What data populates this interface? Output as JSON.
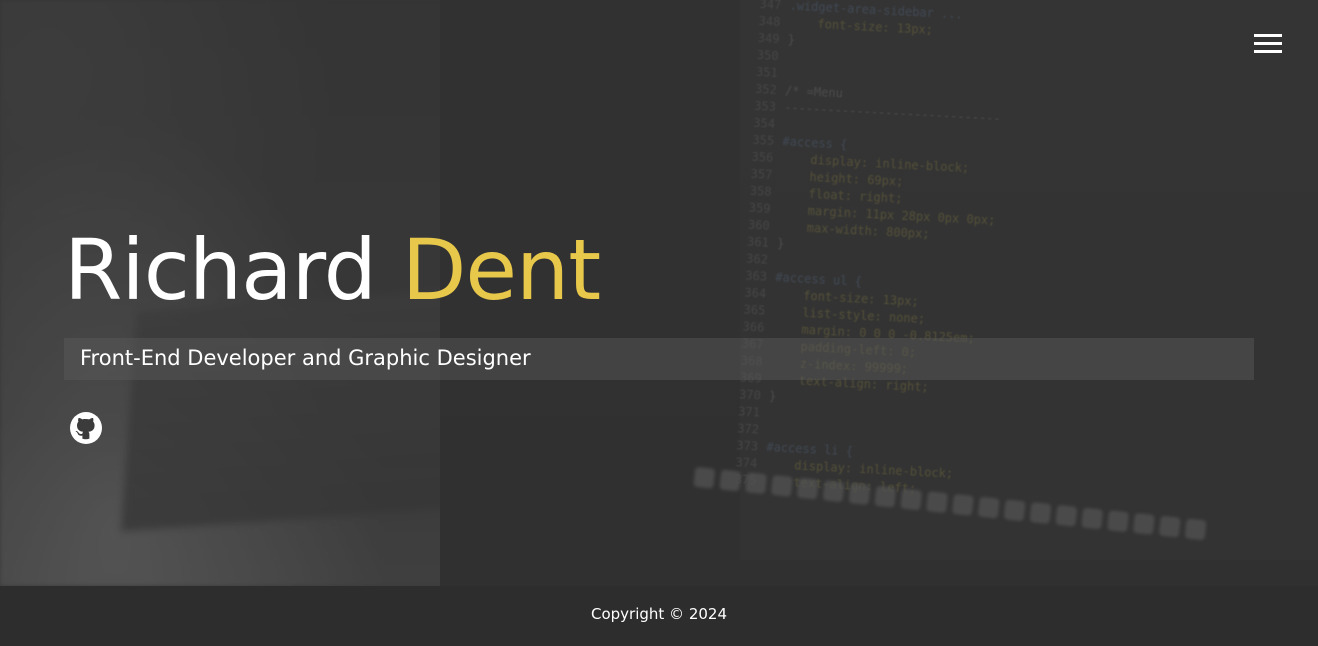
{
  "header": {
    "menu_icon": "hamburger-menu-icon"
  },
  "hero": {
    "first_name": "Richard",
    "last_name": "Dent",
    "subtitle": "Front-End Developer and Graphic Designer",
    "social": {
      "github_icon": "github-icon"
    }
  },
  "background_code": [
    ".widget-area-sidebar ...",
    "    font-size: 13px;",
    "}",
    "",
    "",
    "/* =Menu",
    "------------------------------",
    "",
    "#access {",
    "    display: inline-block;",
    "    height: 69px;",
    "    float: right;",
    "    margin: 11px 28px 0px 0px;",
    "    max-width: 800px;",
    "}",
    "",
    "#access ul {",
    "    font-size: 13px;",
    "    list-style: none;",
    "    margin: 0 0 0 -0.8125em;",
    "    padding-left: 0;",
    "    z-index: 99999;",
    "    text-align: right;",
    "}",
    "",
    "",
    "#access li {",
    "    display: inline-block;",
    "    text-align: left;"
  ],
  "footer": {
    "copyright": "Copyright © 2024"
  },
  "colors": {
    "accent": "#e8c84a",
    "footer_bg": "#2d2d2d",
    "text": "#ffffff"
  }
}
